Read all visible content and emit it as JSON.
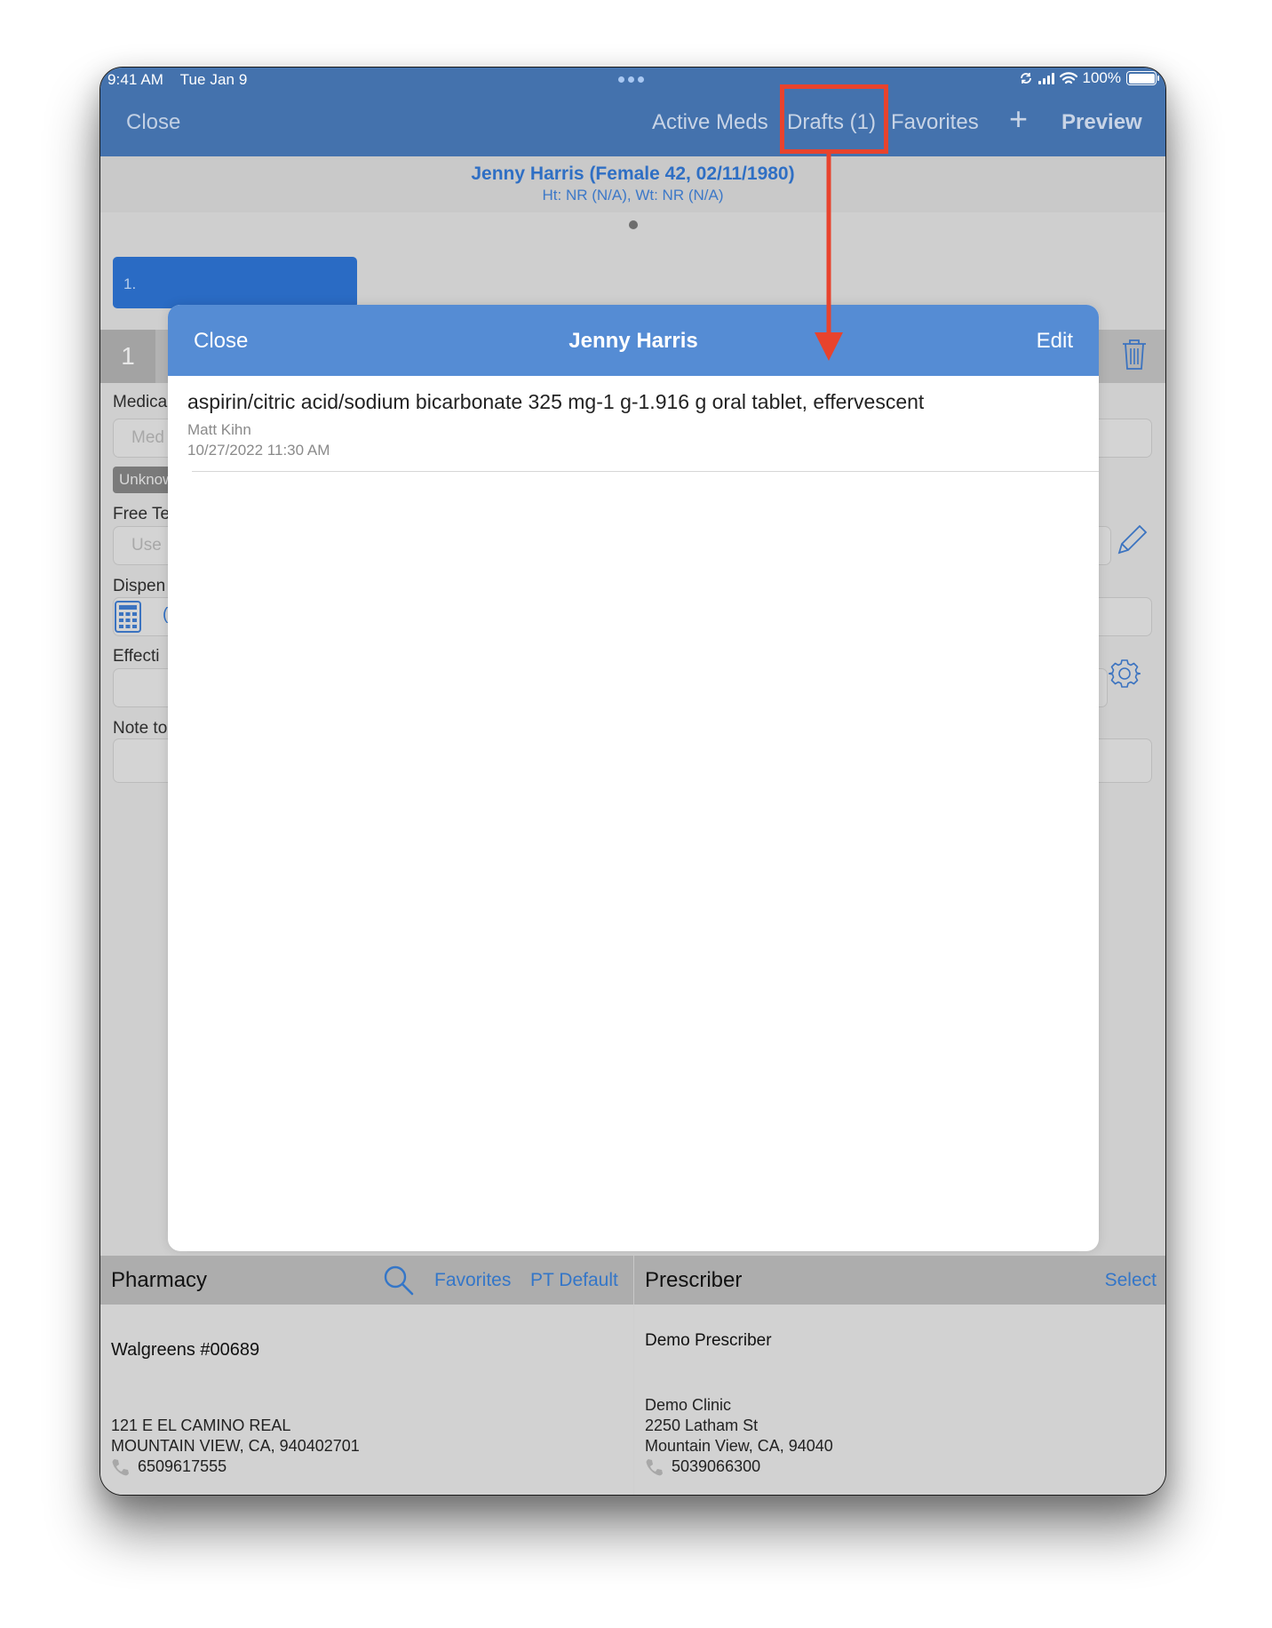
{
  "status_bar": {
    "time": "9:41 AM",
    "date": "Tue Jan 9",
    "battery": "100%",
    "icons": [
      "sync-icon",
      "cellular-signal-icon",
      "wifi-icon",
      "battery-icon"
    ]
  },
  "navbar": {
    "close_label": "Close",
    "items": [
      {
        "label": "Active Meds"
      },
      {
        "label": "Drafts (1)"
      },
      {
        "label": "Favorites"
      }
    ],
    "add_icon": "plus-icon",
    "preview_label": "Preview"
  },
  "patient": {
    "name_line": "Jenny Harris (Female 42, 02/11/1980)",
    "vitals_line": "Ht: NR  (N/A), Wt: NR  (N/A)"
  },
  "prescription_tabs": [
    {
      "label": "1."
    }
  ],
  "prescription_row": {
    "number": "1",
    "delete_icon": "trash-icon"
  },
  "form": {
    "medication_label": "Medica",
    "medication_placeholder": "Med",
    "unknown_badge": "Unknow",
    "free_text_label": "Free Te",
    "free_text_placeholder": "Use",
    "dispense_label": "Dispen",
    "dispense_value": "(",
    "effective_label": "Effecti",
    "note_label": "Note to"
  },
  "modal": {
    "close_label": "Close",
    "title": "Jenny Harris",
    "edit_label": "Edit",
    "drafts": [
      {
        "medication": "aspirin/citric acid/sodium bicarbonate 325 mg-1 g-1.916 g oral tablet, effervescent",
        "author": "Matt Kihn",
        "timestamp": "10/27/2022 11:30 AM"
      }
    ]
  },
  "pharmacy": {
    "title": "Pharmacy",
    "search_icon": "search-icon",
    "favorites_label": "Favorites",
    "pt_default_label": "PT Default",
    "name": "Walgreens #00689",
    "address_line1": "121 E EL CAMINO REAL",
    "address_line2": "MOUNTAIN VIEW, CA, 940402701",
    "phone": "6509617555"
  },
  "prescriber": {
    "title": "Prescriber",
    "select_label": "Select",
    "name": "Demo Prescriber",
    "clinic": "Demo Clinic",
    "address_line1": "2250 Latham St",
    "address_line2": "Mountain View, CA, 94040",
    "phone": "5039066300"
  },
  "annotation": {
    "highlight_target": "Drafts (1)",
    "color": "#e8432d"
  },
  "colors": {
    "navbar": "#4472ad",
    "modal_header": "#558cd4",
    "link_blue": "#3476c8",
    "tab_blue": "#2a6bc4"
  }
}
